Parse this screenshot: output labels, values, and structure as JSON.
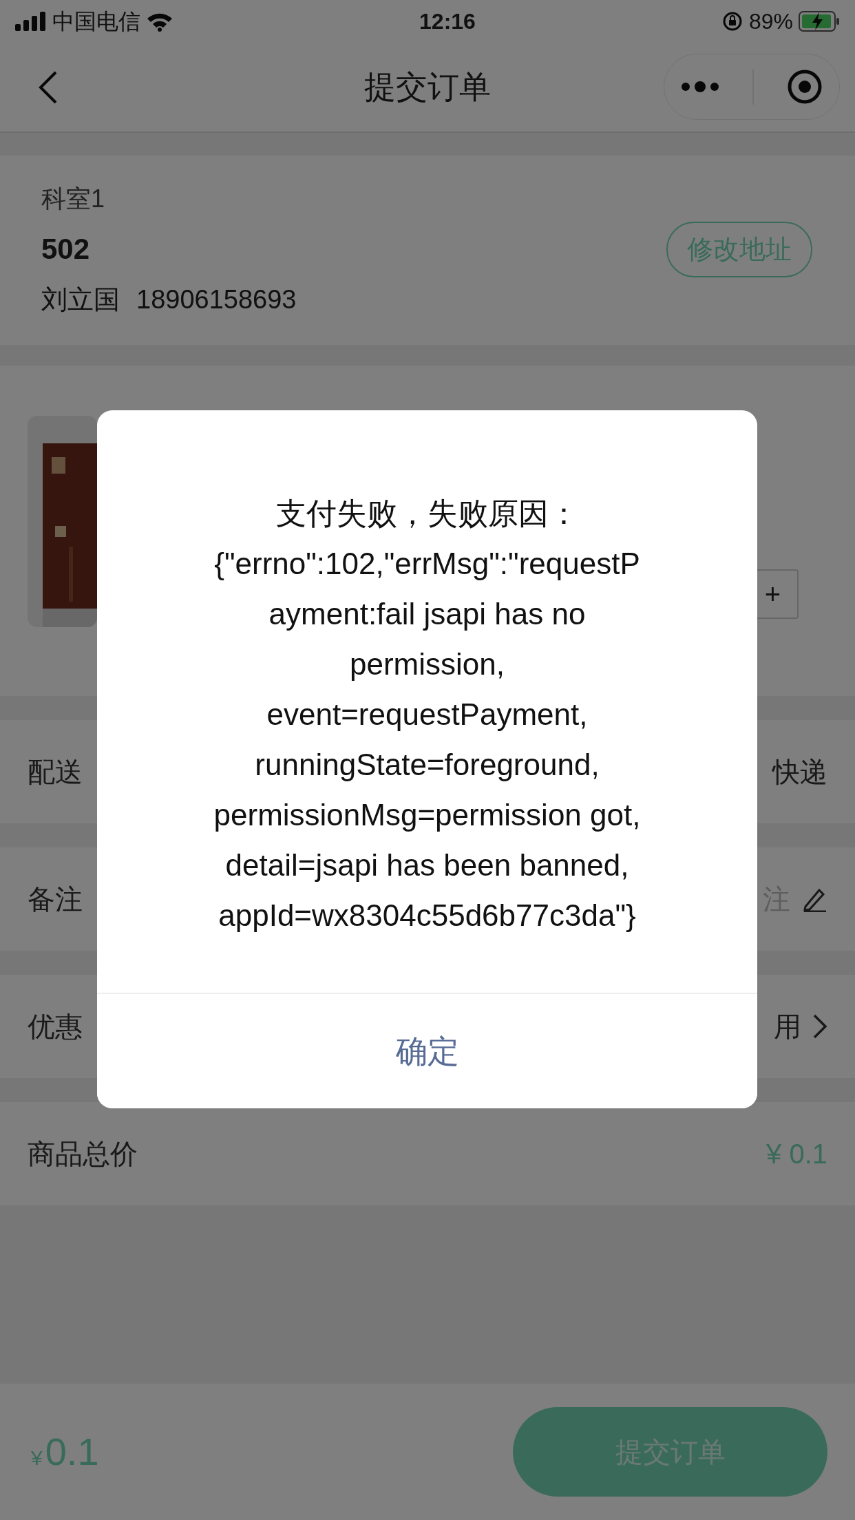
{
  "status_bar": {
    "carrier": "中国电信",
    "time": "12:16",
    "battery": "89%"
  },
  "nav": {
    "title": "提交订单"
  },
  "address": {
    "department": "科室1",
    "room": "502",
    "name": "刘立国",
    "phone": "18906158693",
    "edit_button": "修改地址"
  },
  "product": {
    "kind": "picture",
    "stepper_plus": "+"
  },
  "rows": [
    {
      "kind": "text",
      "label": "配送",
      "value": "快递"
    },
    {
      "kind": "input",
      "label": "备注",
      "placeholder": "注"
    },
    {
      "kind": "link",
      "label": "优惠",
      "value": "用"
    },
    {
      "kind": "price",
      "label": "商品总价",
      "value": "¥ 0.1"
    }
  ],
  "footer": {
    "currency": "¥",
    "amount": "0.1",
    "submit_button": "提交订单"
  },
  "dialog": {
    "message_lines": [
      "支付失败，失败原因：",
      "{\"errno\":102,\"errMsg\":\"requestP",
      "ayment:fail jsapi has no",
      "permission,",
      "event=requestPayment,",
      "runningState=foreground,",
      "permissionMsg=permission got,",
      "detail=jsapi has been banned,",
      "appId=wx8304c55d6b77c3da\"}"
    ],
    "confirm_button": "确定"
  }
}
